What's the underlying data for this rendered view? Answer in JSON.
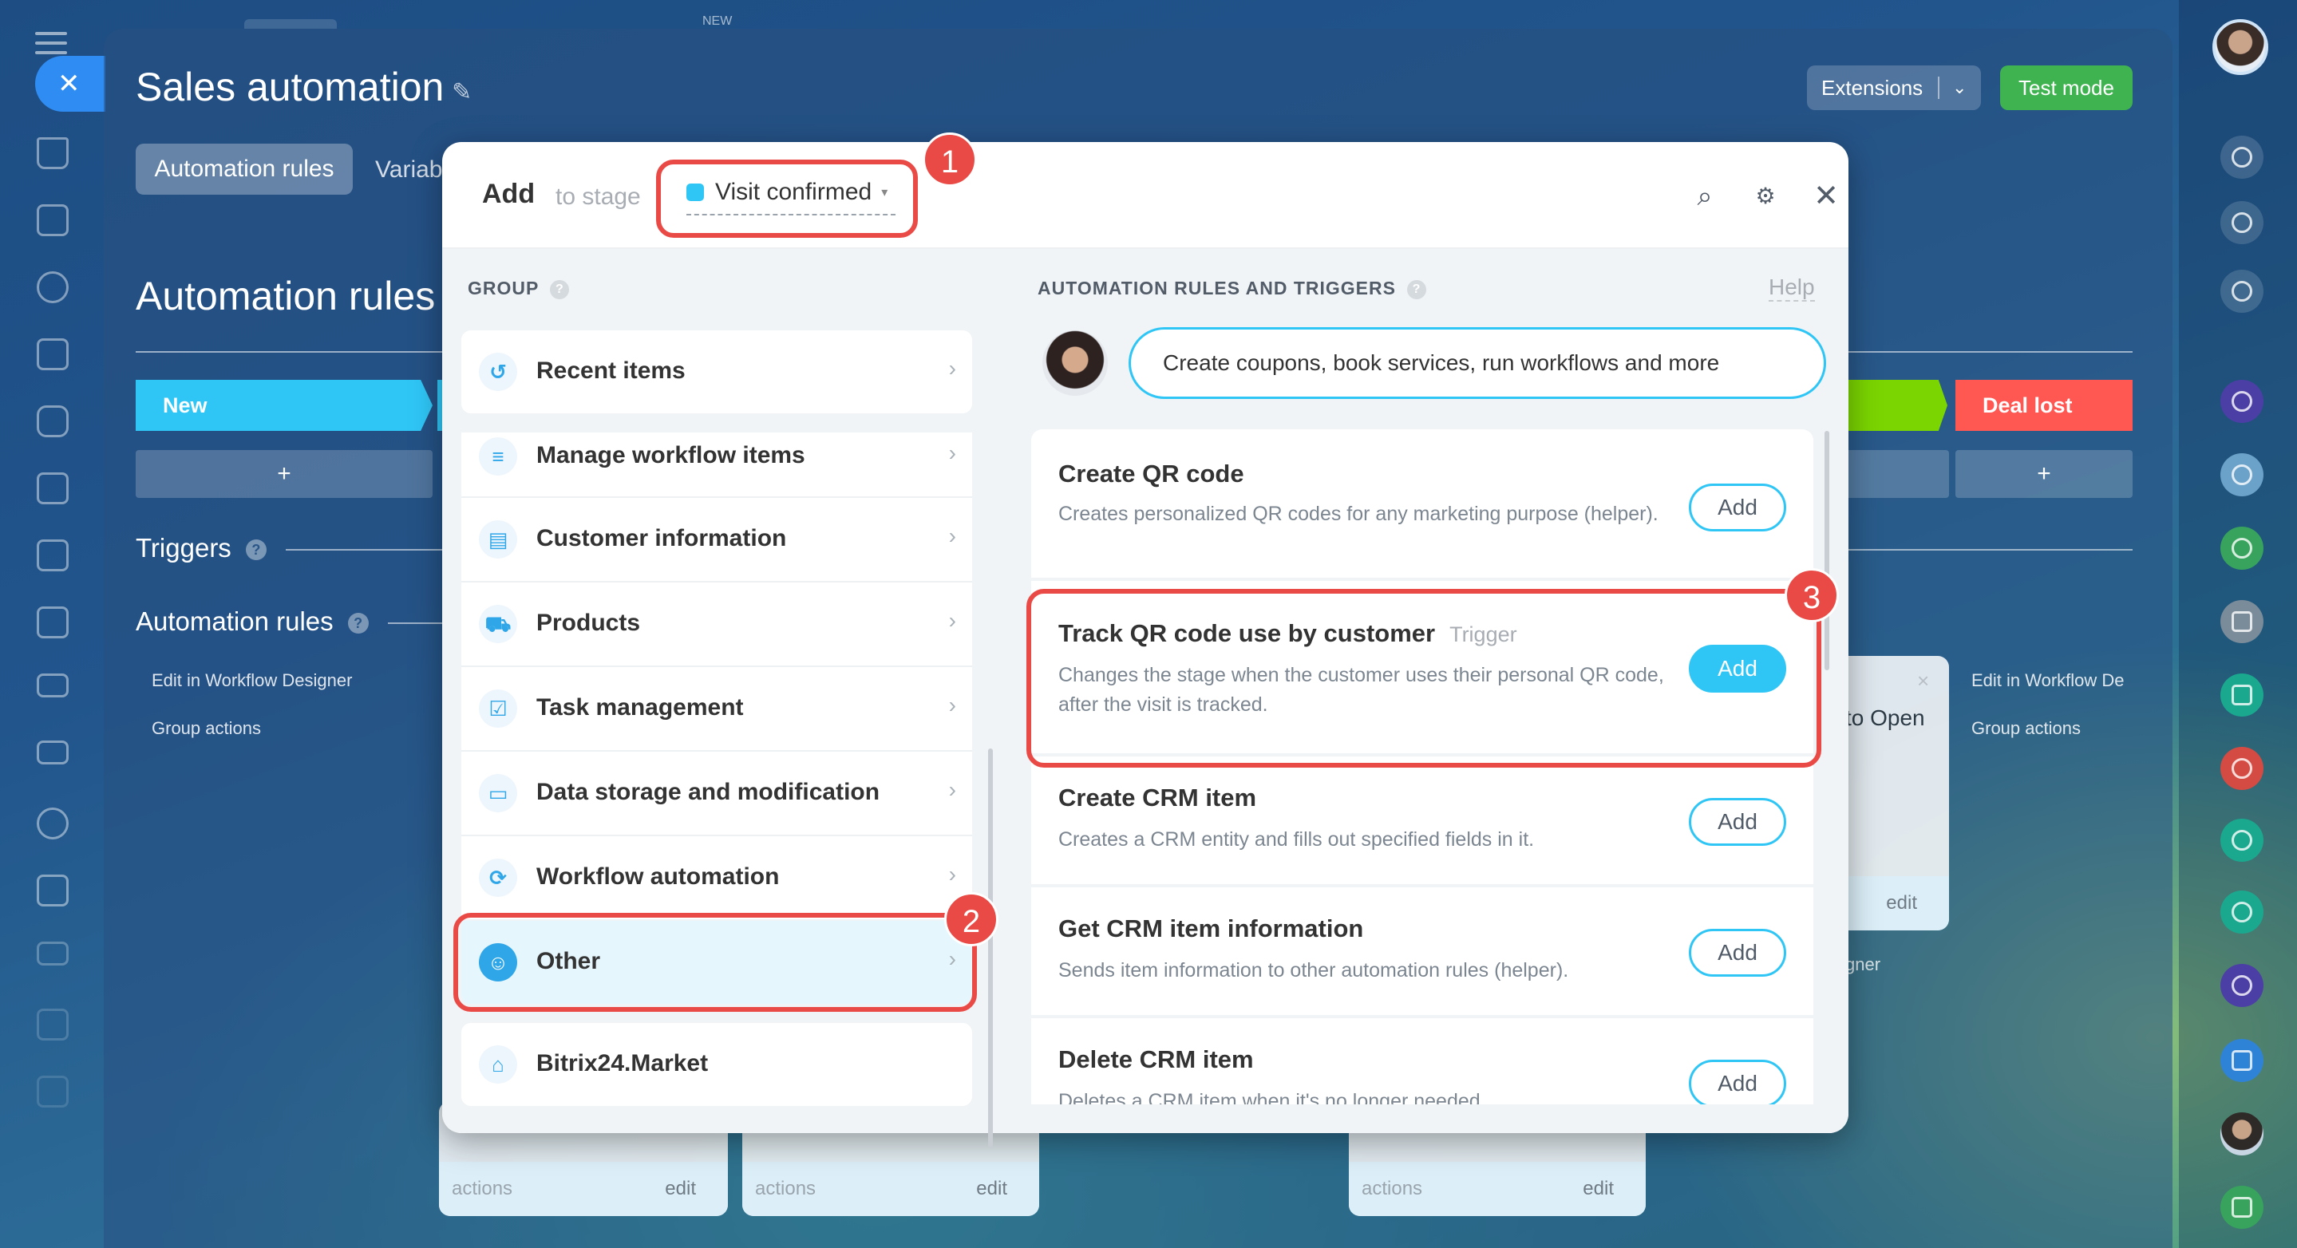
{
  "header": {
    "title": "Sales automation",
    "new_badge": "NEW",
    "extensions_label": "Extensions",
    "test_mode_label": "Test mode"
  },
  "tabs": {
    "automation_rules": "Automation rules",
    "variables": "Variab"
  },
  "page": {
    "section_title": "Automation rules",
    "stage_new": "New",
    "stage_deal_lost": "Deal lost",
    "plus": "+",
    "triggers_label": "Triggers",
    "automation_rules_label": "Automation rules",
    "edit_in_designer": "Edit in Workflow Designer",
    "group_actions": "Group actions",
    "edit_in_designer_right": "Edit in Workflow De",
    "group_actions_right": "Group actions",
    "to_open_text": "to Open",
    "card_edit": "edit",
    "designer_partial": "gner",
    "card_actions": "actions"
  },
  "modal": {
    "add_label": "Add",
    "to_stage_label": "to stage",
    "stage_name": "Visit confirmed",
    "stage_color": "#2fc6f6",
    "group_header": "GROUP",
    "rules_header": "AUTOMATION RULES AND TRIGGERS",
    "help_link": "Help",
    "bubble_text": "Create coupons, book services, run workflows and more",
    "groups": [
      {
        "label": "Recent items",
        "icon": "history-icon"
      },
      {
        "label": "Manage workflow items",
        "icon": "filter-icon"
      },
      {
        "label": "Customer information",
        "icon": "contact-card-icon"
      },
      {
        "label": "Products",
        "icon": "cart-icon"
      },
      {
        "label": "Task management",
        "icon": "task-check-icon"
      },
      {
        "label": "Data storage and modification",
        "icon": "database-icon"
      },
      {
        "label": "Workflow automation",
        "icon": "workflow-cycle-icon"
      },
      {
        "label": "Other",
        "icon": "robot-icon"
      },
      {
        "label": "Bitrix24.Market",
        "icon": "market-bag-icon"
      }
    ],
    "rules": [
      {
        "title": "Create QR code",
        "tag": "",
        "desc": "Creates personalized QR codes for any marketing purpose (helper).",
        "button": "Add"
      },
      {
        "title": "Track QR code use by customer",
        "tag": "Trigger",
        "desc": "Changes the stage when the customer uses their personal QR code, after the visit is tracked.",
        "button": "Add"
      },
      {
        "title": "Create CRM item",
        "tag": "",
        "desc": "Creates a CRM entity and fills out specified fields in it.",
        "button": "Add"
      },
      {
        "title": "Get CRM item information",
        "tag": "",
        "desc": "Sends item information to other automation rules (helper).",
        "button": "Add"
      },
      {
        "title": "Delete CRM item",
        "tag": "",
        "desc": "Deletes a CRM item when it's no longer needed.",
        "button": "Add"
      }
    ],
    "callouts": [
      "1",
      "2",
      "3"
    ]
  },
  "colors": {
    "accent": "#2fc6f6",
    "highlight": "#ea4a45",
    "test_mode": "#3fb34f",
    "deal_lost": "#ff5752"
  }
}
